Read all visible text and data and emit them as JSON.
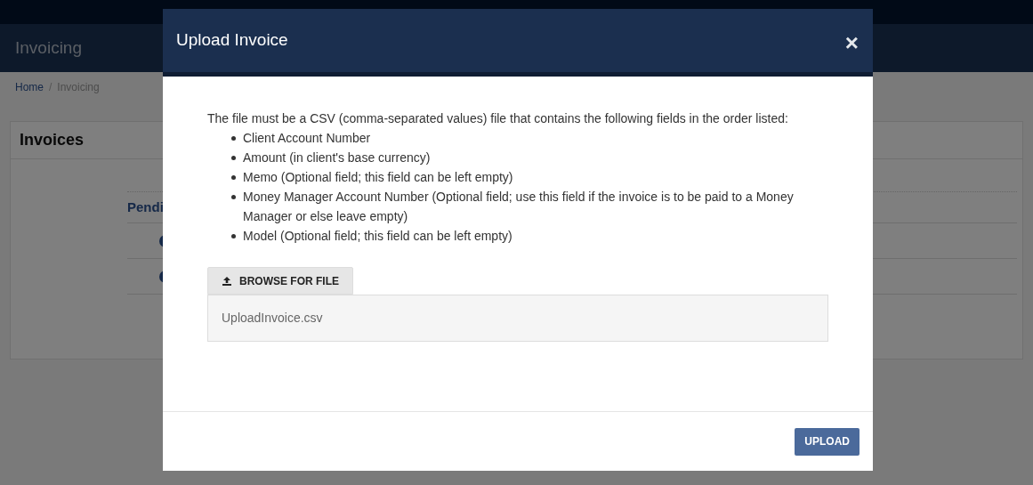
{
  "page": {
    "app_title": "Invoicing",
    "breadcrumb_separator": "/",
    "breadcrumb": [
      {
        "label": "Home",
        "selected": false
      },
      {
        "label": "Invoicing",
        "selected": true
      }
    ],
    "panel_title": "Invoices",
    "section_heading": "Pendi",
    "rows": [
      {
        "kind": "dot"
      },
      {
        "kind": "dot"
      }
    ]
  },
  "modal": {
    "title": "Upload Invoice",
    "close": "×",
    "intro": "The file must be a CSV (comma-separated values) file that contains the following fields in the order listed:",
    "fields": [
      "Client Account Number",
      "Amount (in client's base currency)",
      "Memo (Optional field; this field can be left empty)",
      "Money Manager Account Number (Optional field; use this field if the invoice is to be paid to a Money Manager or else leave empty)",
      "Model (Optional field; this field can be left empty)"
    ],
    "browse_button": "BROWSE FOR FILE",
    "file_name": "UploadInvoice.csv",
    "upload_button": "UPLOAD"
  }
}
